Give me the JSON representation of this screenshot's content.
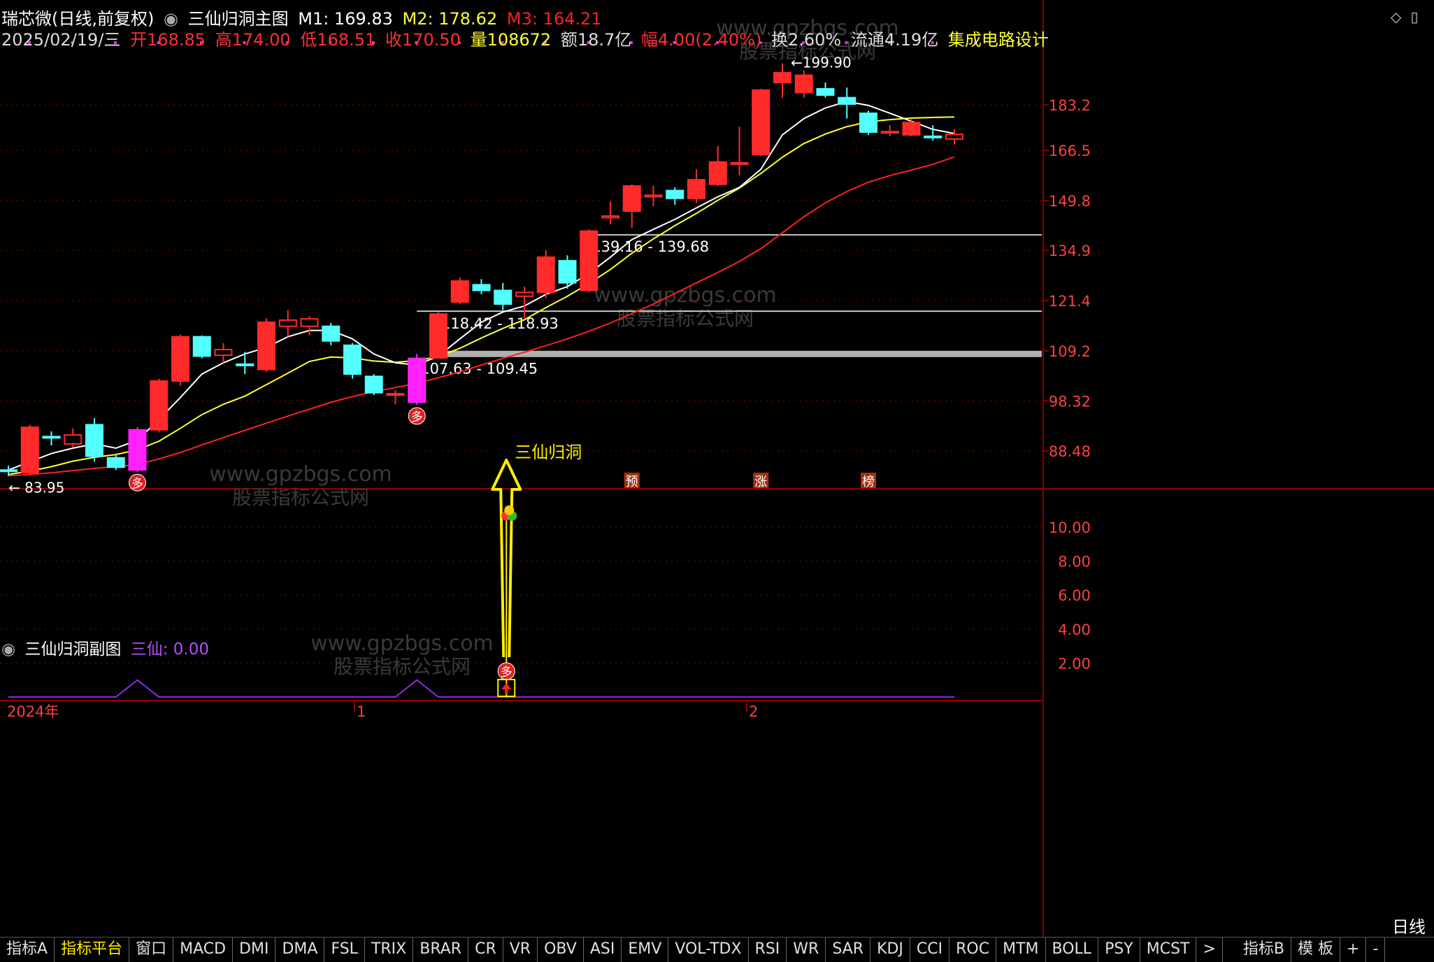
{
  "header": {
    "stock_name": "瑞芯微(日线,前复权)",
    "indicator_name": "三仙归洞主图",
    "m1": "M1: 169.83",
    "m2": "M2: 178.62",
    "m3": "M3: 164.21",
    "date": "2025/02/19/三",
    "open": "开168.85",
    "high": "高174.00",
    "low": "低168.51",
    "close": "收170.50",
    "volume": "量108672",
    "amount": "额18.7亿",
    "change": "幅4.00(2.40%)",
    "turnover": "换2.60%",
    "float": "流通4.19亿",
    "sector": "集成电路设计"
  },
  "sub_header": {
    "indicator_name": "三仙归洞副图",
    "value": "三仙: 0.00"
  },
  "watermark": {
    "url": "www.gpzbgs.com",
    "name": "股票指标公式网"
  },
  "colors": {
    "up": "#ff2a2a",
    "down": "#54ffff",
    "pink": "#ff22ff",
    "m1": "#ffffff",
    "m2": "#ffff33",
    "m3": "#ff2020",
    "grid": "#8b0000"
  },
  "chart_data": [
    {
      "type": "candlestick",
      "title": "三仙归洞主图",
      "price_axis_ticks": [
        "183.2",
        "166.5",
        "149.8",
        "134.9",
        "121.4",
        "109.2",
        "98.32",
        "88.48"
      ],
      "price_axis_values": [
        183.2,
        166.5,
        149.8,
        134.9,
        121.4,
        109.2,
        98.32,
        88.48
      ],
      "candles": [
        {
          "o": 85.0,
          "h": 85.8,
          "l": 83.95,
          "c": 84.8
        },
        {
          "o": 84.5,
          "h": 93.5,
          "l": 84.0,
          "c": 93.0
        },
        {
          "o": 91.2,
          "h": 92.2,
          "l": 89.5,
          "c": 91.0
        },
        {
          "o": 89.8,
          "h": 92.8,
          "l": 89.2,
          "c": 91.5
        },
        {
          "o": 93.5,
          "h": 94.8,
          "l": 86.5,
          "c": 87.5
        },
        {
          "o": 87.2,
          "h": 88.0,
          "l": 85.0,
          "c": 85.5
        },
        {
          "o": 85.0,
          "h": 93.0,
          "l": 84.6,
          "c": 92.5
        },
        {
          "o": 92.5,
          "h": 103.0,
          "l": 92.0,
          "c": 102.5
        },
        {
          "o": 102.5,
          "h": 113.0,
          "l": 101.5,
          "c": 112.5
        },
        {
          "o": 112.5,
          "h": 112.8,
          "l": 107.5,
          "c": 108.0
        },
        {
          "o": 108.2,
          "h": 111.0,
          "l": 106.5,
          "c": 109.5
        },
        {
          "o": 106.2,
          "h": 109.0,
          "l": 104.0,
          "c": 106.0
        },
        {
          "o": 105.0,
          "h": 117.0,
          "l": 104.5,
          "c": 116.0
        },
        {
          "o": 115.0,
          "h": 119.0,
          "l": 112.5,
          "c": 116.5
        },
        {
          "o": 115.0,
          "h": 117.5,
          "l": 112.8,
          "c": 116.8
        },
        {
          "o": 115.0,
          "h": 115.8,
          "l": 110.5,
          "c": 111.5
        },
        {
          "o": 110.5,
          "h": 111.0,
          "l": 103.0,
          "c": 104.0
        },
        {
          "o": 103.5,
          "h": 104.0,
          "l": 99.5,
          "c": 100.0
        },
        {
          "o": 99.5,
          "h": 100.5,
          "l": 97.6,
          "c": 99.8
        },
        {
          "o": 98.0,
          "h": 108.5,
          "l": 97.5,
          "c": 107.5
        },
        {
          "o": 107.6,
          "h": 118.5,
          "l": 107.5,
          "c": 118.0
        },
        {
          "o": 121.0,
          "h": 127.5,
          "l": 120.5,
          "c": 126.5
        },
        {
          "o": 125.5,
          "h": 127.0,
          "l": 123.0,
          "c": 124.0
        },
        {
          "o": 124.0,
          "h": 126.0,
          "l": 119.0,
          "c": 120.5
        },
        {
          "o": 122.5,
          "h": 125.0,
          "l": 117.0,
          "c": 123.5
        },
        {
          "o": 123.5,
          "h": 135.0,
          "l": 122.0,
          "c": 133.0
        },
        {
          "o": 132.0,
          "h": 133.5,
          "l": 124.5,
          "c": 126.0
        },
        {
          "o": 124.0,
          "h": 141.0,
          "l": 123.5,
          "c": 140.5
        },
        {
          "o": 144.5,
          "h": 149.5,
          "l": 142.5,
          "c": 145.0
        },
        {
          "o": 146.5,
          "h": 155.0,
          "l": 141.5,
          "c": 154.5
        },
        {
          "o": 151.0,
          "h": 154.5,
          "l": 148.0,
          "c": 151.5
        },
        {
          "o": 153.0,
          "h": 154.0,
          "l": 148.5,
          "c": 150.5
        },
        {
          "o": 150.5,
          "h": 160.0,
          "l": 149.0,
          "c": 156.5
        },
        {
          "o": 155.0,
          "h": 168.0,
          "l": 154.5,
          "c": 162.5
        },
        {
          "o": 162.0,
          "h": 175.0,
          "l": 158.0,
          "c": 162.2
        },
        {
          "o": 165.0,
          "h": 189.5,
          "l": 164.5,
          "c": 189.0
        },
        {
          "o": 192.0,
          "h": 199.9,
          "l": 186.0,
          "c": 196.0
        },
        {
          "o": 188.0,
          "h": 197.0,
          "l": 186.0,
          "c": 195.0
        },
        {
          "o": 189.5,
          "h": 192.0,
          "l": 186.0,
          "c": 187.0
        },
        {
          "o": 186.0,
          "h": 190.0,
          "l": 178.0,
          "c": 183.5
        },
        {
          "o": 180.0,
          "h": 181.0,
          "l": 172.0,
          "c": 173.0
        },
        {
          "o": 173.0,
          "h": 175.5,
          "l": 171.5,
          "c": 173.2
        },
        {
          "o": 172.0,
          "h": 178.0,
          "l": 171.5,
          "c": 176.5
        },
        {
          "o": 171.5,
          "h": 175.5,
          "l": 170.0,
          "c": 171.0
        },
        {
          "o": 170.5,
          "h": 174.0,
          "l": 168.51,
          "c": 172.2
        }
      ],
      "special_candles": [
        6,
        19
      ],
      "m1_line": [
        85.0,
        86.5,
        88.0,
        89.0,
        89.8,
        89.0,
        90.5,
        94.5,
        99.0,
        104.0,
        106.5,
        108.5,
        110.0,
        112.5,
        114.0,
        114.0,
        112.0,
        108.5,
        106.5,
        106.0,
        108.0,
        112.0,
        116.0,
        118.5,
        120.0,
        123.0,
        125.0,
        128.5,
        133.0,
        138.0,
        141.0,
        144.0,
        147.5,
        151.0,
        154.0,
        160.0,
        172.0,
        178.0,
        182.0,
        184.5,
        183.0,
        180.0,
        177.0,
        174.0,
        172.5
      ],
      "m2_line": [
        84.2,
        84.8,
        85.6,
        86.6,
        87.3,
        87.8,
        88.7,
        90.3,
        92.8,
        95.5,
        97.6,
        99.3,
        101.7,
        104.2,
        106.8,
        107.8,
        107.6,
        106.9,
        106.6,
        107.0,
        107.9,
        109.8,
        112.2,
        114.5,
        116.6,
        119.6,
        122.5,
        125.8,
        129.6,
        134.1,
        138.2,
        142.1,
        145.8,
        149.9,
        153.8,
        158.6,
        164.1,
        168.9,
        172.3,
        175.0,
        176.8,
        177.6,
        178.2,
        178.4,
        178.6
      ],
      "m3_line": [
        84.0,
        84.2,
        84.5,
        84.9,
        85.3,
        85.6,
        86.0,
        87.0,
        88.2,
        89.6,
        91.0,
        92.4,
        93.8,
        95.2,
        96.6,
        98.0,
        99.2,
        100.2,
        101.1,
        102.0,
        103.2,
        104.5,
        106.0,
        107.5,
        108.9,
        110.4,
        112.0,
        113.8,
        115.8,
        118.1,
        120.5,
        123.2,
        126.0,
        128.8,
        131.8,
        135.4,
        140.0,
        144.8,
        149.1,
        152.7,
        155.7,
        157.9,
        159.7,
        161.7,
        164.21
      ],
      "support_levels": [
        {
          "label": "107.63 - 109.45",
          "value": 108.5
        },
        {
          "label": "118.42 - 118.93",
          "value": 118.7
        },
        {
          "label": "139.16 - 139.68",
          "value": 139.4
        }
      ],
      "annotations": {
        "signal_text": "三仙归洞",
        "low_label": "← 83.95",
        "high_label": "←199.90",
        "markers": [
          "预",
          "涨",
          "榜"
        ],
        "signal_glyph": "多"
      }
    },
    {
      "type": "line",
      "title": "三仙归洞副图",
      "y_axis_ticks": [
        "10.00",
        "8.00",
        "6.00",
        "4.00",
        "2.00"
      ],
      "y_axis_values": [
        10,
        8,
        6,
        4,
        2
      ],
      "signal_index": 23,
      "signal_value": 10.5,
      "bumps": [
        6,
        19
      ],
      "x_labels": [
        "2024年",
        "1",
        "2"
      ]
    }
  ],
  "bottom_right": "日线",
  "tabs": [
    "指标A",
    "指标平台",
    "窗口",
    "MACD",
    "DMI",
    "DMA",
    "FSL",
    "TRIX",
    "BRAR",
    "CR",
    "VR",
    "OBV",
    "ASI",
    "EMV",
    "VOL-TDX",
    "RSI",
    "WR",
    "SAR",
    "KDJ",
    "CCI",
    "ROC",
    "MTM",
    "BOLL",
    "PSY",
    "MCST",
    ">",
    "指标B",
    "模 板",
    "+",
    "-"
  ],
  "active_tab": 1
}
